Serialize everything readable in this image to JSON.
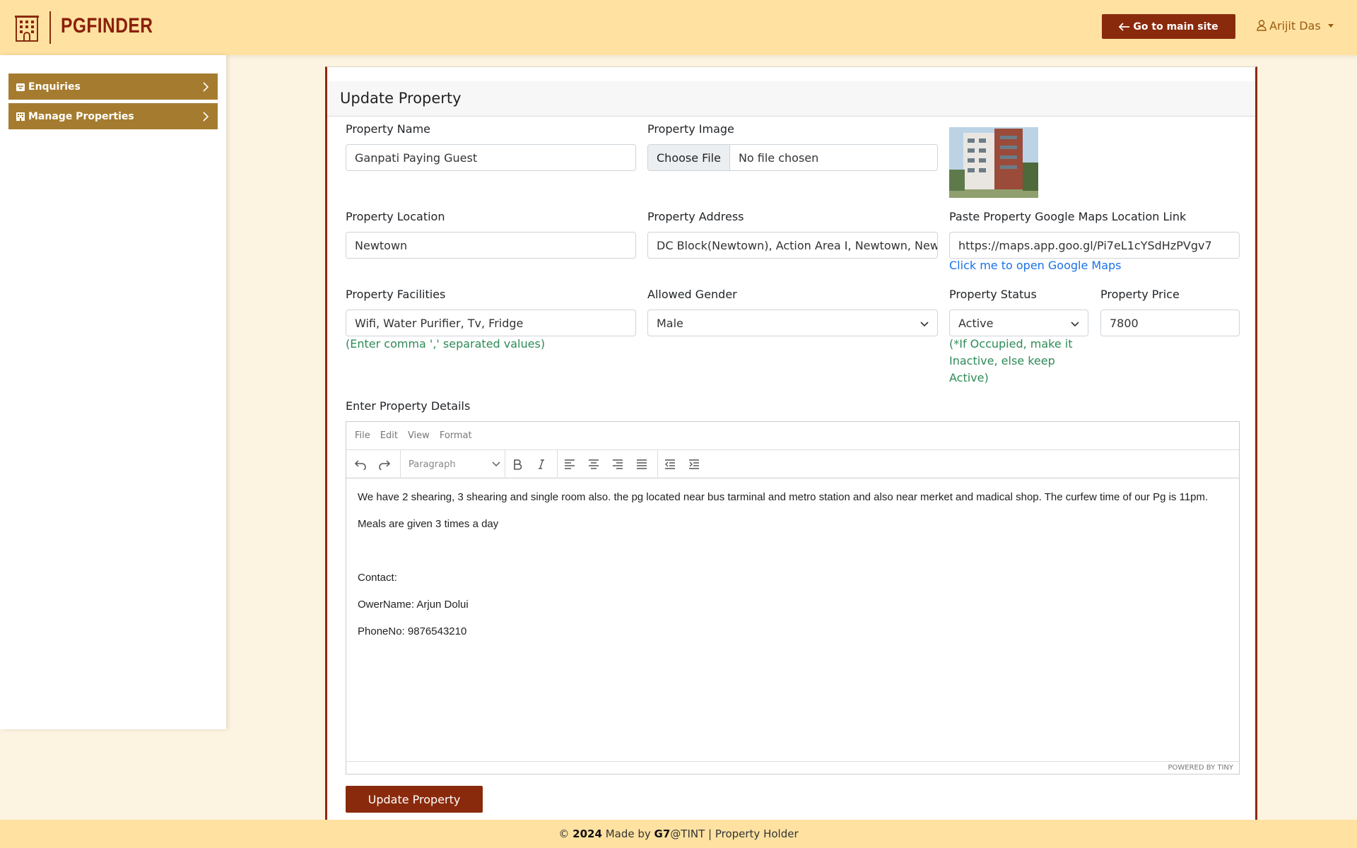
{
  "header": {
    "brand": "PGFINDER",
    "main_site_button": "Go to main site",
    "user_name": "Arijit Das"
  },
  "sidebar": {
    "items": [
      {
        "label": "Enquiries",
        "icon": "inbox-icon"
      },
      {
        "label": "Manage Properties",
        "icon": "building-icon"
      }
    ]
  },
  "form": {
    "title": "Update Property",
    "property_name": {
      "label": "Property Name",
      "value": "Ganpati Paying Guest"
    },
    "property_image": {
      "label": "Property Image",
      "button": "Choose File",
      "status": "No file chosen"
    },
    "property_location": {
      "label": "Property Location",
      "value": "Newtown"
    },
    "property_address": {
      "label": "Property Address",
      "value": "DC Block(Newtown), Action Area I, Newtown, New"
    },
    "maps_link": {
      "label": "Paste Property Google Maps Location Link",
      "value": "https://maps.app.goo.gl/Pi7eL1cYSdHzPVgv7",
      "link_text": "Click me to open Google Maps"
    },
    "facilities": {
      "label": "Property Facilities",
      "value": "Wifi, Water Purifier, Tv, Fridge",
      "hint": "(Enter comma ',' separated values)"
    },
    "gender": {
      "label": "Allowed Gender",
      "value": "Male"
    },
    "status": {
      "label": "Property Status",
      "value": "Active",
      "hint": "(*If Occupied, make it Inactive, else keep Active)"
    },
    "price": {
      "label": "Property Price",
      "value": "7800"
    },
    "details_label": "Enter Property Details",
    "submit": "Update Property"
  },
  "editor": {
    "menus": [
      "File",
      "Edit",
      "View",
      "Format"
    ],
    "block_format": "Paragraph",
    "paragraphs": [
      "We have 2 shearing, 3 shearing and single room also. the pg located near bus tarminal and metro station and also near merket and madical shop. The curfew time of our Pg is 11pm.",
      "Meals are given 3 times a day",
      "",
      "Contact:",
      "OwerName: Arjun Dolui",
      "PhoneNo: 9876543210"
    ],
    "powered_by": "POWERED BY TINY"
  },
  "footer": {
    "copyright": "©",
    "year": "2024",
    "made_by": "Made by",
    "team": "G7",
    "org": "@TINT | Property Holder"
  }
}
